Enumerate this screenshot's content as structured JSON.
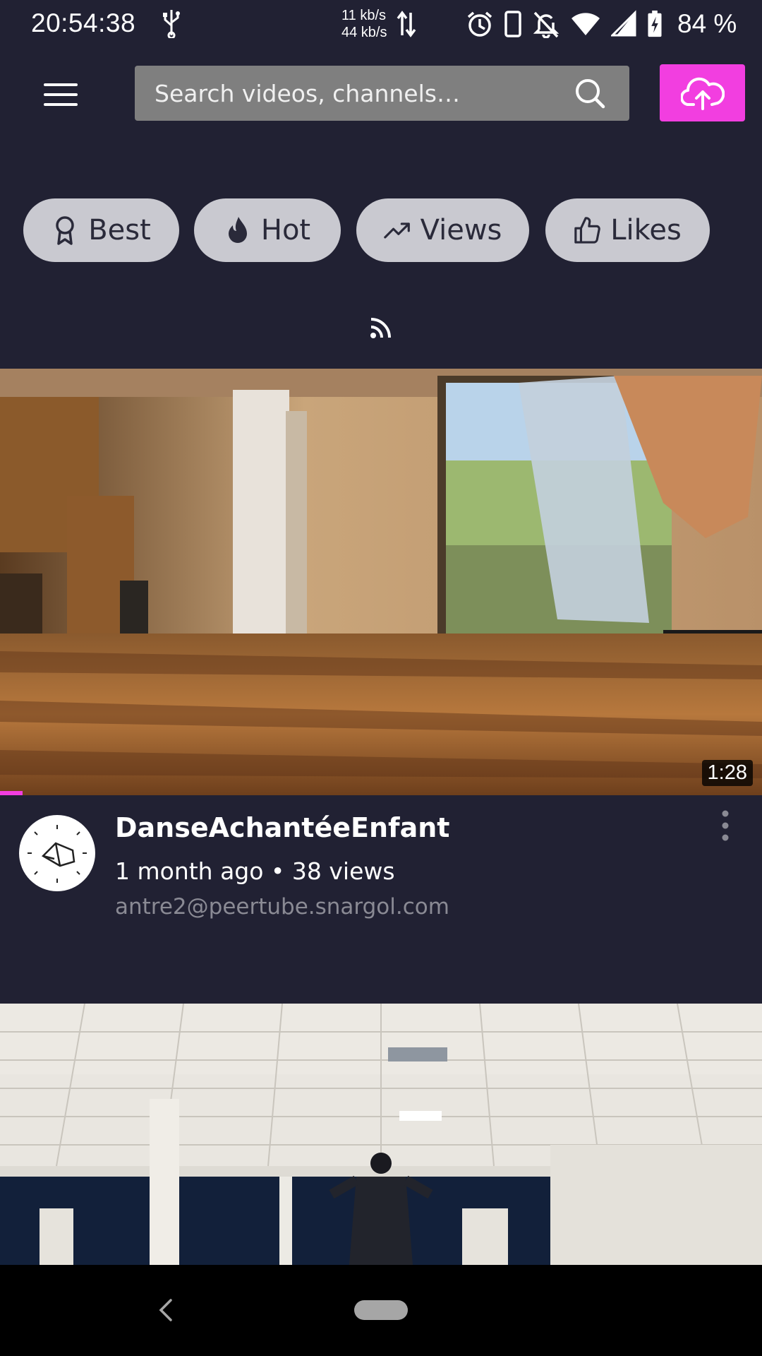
{
  "status_bar": {
    "time": "20:54:38",
    "net_up": "11 kb/s",
    "net_down": "44 kb/s",
    "battery": "84 %",
    "icons": [
      "usb-icon",
      "network-arrows-icon",
      "alarm-icon",
      "phone-icon",
      "bell-off-icon",
      "wifi-icon",
      "signal-icon",
      "battery-charging-icon"
    ]
  },
  "header": {
    "search_placeholder": "Search videos, channels…",
    "accent_color": "#f23ee0"
  },
  "filters": [
    {
      "label": "Best",
      "icon": "award-icon"
    },
    {
      "label": "Hot",
      "icon": "flame-icon"
    },
    {
      "label": "Views",
      "icon": "trending-up-icon"
    },
    {
      "label": "Likes",
      "icon": "thumbs-up-icon"
    }
  ],
  "videos": [
    {
      "title": "DanseAchantéeEnfant",
      "meta": "1 month ago • 38 views",
      "channel": "antre2@peertube.snargol.com",
      "duration": "1:28",
      "watch_progress": 0.03
    },
    {
      "thumbnail": "gym-hall-thumbnail"
    }
  ]
}
